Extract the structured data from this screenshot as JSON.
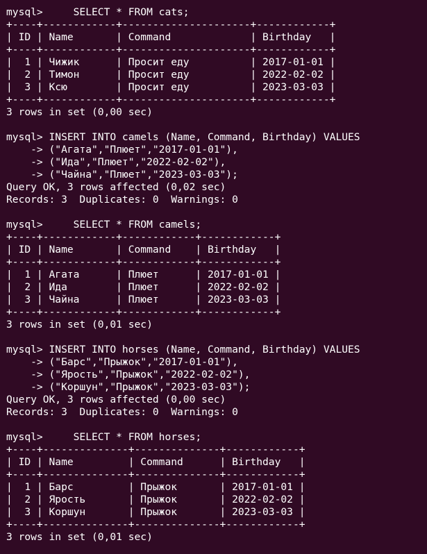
{
  "terminal": {
    "lines": [
      "mysql>     SELECT * FROM cats;",
      "+----+------------+---------------------+------------+",
      "| ID | Name       | Command             | Birthday   |",
      "+----+------------+---------------------+------------+",
      "|  1 | Чижик      | Просит еду          | 2017-01-01 |",
      "|  2 | Тимон      | Просит еду          | 2022-02-02 |",
      "|  3 | Ксю        | Просит еду          | 2023-03-03 |",
      "+----+------------+---------------------+------------+",
      "3 rows in set (0,00 sec)",
      "",
      "mysql> INSERT INTO camels (Name, Command, Birthday) VALUES",
      "    -> (\"Агата\",\"Плюет\",\"2017-01-01\"),",
      "    -> (\"Ида\",\"Плюет\",\"2022-02-02\"),",
      "    -> (\"Чайна\",\"Плюет\",\"2023-03-03\");",
      "Query OK, 3 rows affected (0,02 sec)",
      "Records: 3  Duplicates: 0  Warnings: 0",
      "",
      "mysql>     SELECT * FROM camels;",
      "+----+------------+------------+------------+",
      "| ID | Name       | Command    | Birthday   |",
      "+----+------------+------------+------------+",
      "|  1 | Агата      | Плюет      | 2017-01-01 |",
      "|  2 | Ида        | Плюет      | 2022-02-02 |",
      "|  3 | Чайна      | Плюет      | 2023-03-03 |",
      "+----+------------+------------+------------+",
      "3 rows in set (0,01 sec)",
      "",
      "mysql> INSERT INTO horses (Name, Command, Birthday) VALUES",
      "    -> (\"Барс\",\"Прыжок\",\"2017-01-01\"),",
      "    -> (\"Ярость\",\"Прыжок\",\"2022-02-02\"),",
      "    -> (\"Коршун\",\"Прыжок\",\"2023-03-03\");",
      "Query OK, 3 rows affected (0,00 sec)",
      "Records: 3  Duplicates: 0  Warnings: 0",
      "",
      "mysql>     SELECT * FROM horses;",
      "+----+--------------+--------------+------------+",
      "| ID | Name         | Command      | Birthday   |",
      "+----+--------------+--------------+------------+",
      "|  1 | Барс         | Прыжок       | 2017-01-01 |",
      "|  2 | Ярость       | Прыжок       | 2022-02-02 |",
      "|  3 | Коршун       | Прыжок       | 2023-03-03 |",
      "+----+--------------+--------------+------------+",
      "3 rows in set (0,01 sec)"
    ]
  }
}
